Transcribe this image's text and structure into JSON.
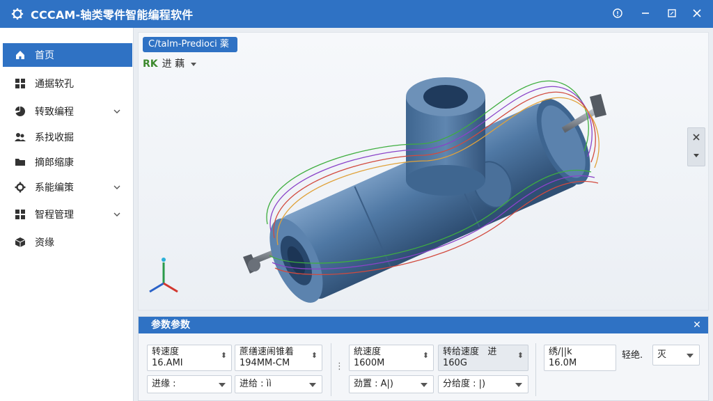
{
  "app": {
    "title": "CCCAM-轴类零件智能编程软件"
  },
  "window_controls": [
    "info-icon",
    "minimize-icon",
    "maximize-icon",
    "close-icon"
  ],
  "sidebar": {
    "items": [
      {
        "label": "首页",
        "icon": "home-icon",
        "active": true,
        "expandable": false
      },
      {
        "label": "通据软孔",
        "icon": "grid-icon",
        "active": false,
        "expandable": false
      },
      {
        "label": "转致编程",
        "icon": "pie-chart-icon",
        "active": false,
        "expandable": true
      },
      {
        "label": "系找收掘",
        "icon": "users-icon",
        "active": false,
        "expandable": false
      },
      {
        "label": "摘郎缩康",
        "icon": "folder-icon",
        "active": false,
        "expandable": false
      },
      {
        "label": "系能编策",
        "icon": "gear-icon",
        "active": false,
        "expandable": true
      },
      {
        "label": "智程管理",
        "icon": "apps-icon",
        "active": false,
        "expandable": true
      },
      {
        "label": "资缘",
        "icon": "box-icon",
        "active": false,
        "expandable": false
      }
    ]
  },
  "viewport": {
    "path_pill": "C/talm-Predioci 薬",
    "rk_code": "RK",
    "rk_label": "进 藕"
  },
  "param_panel": {
    "title": "参数参数",
    "fields": [
      {
        "label": "转速度",
        "value": "16.AMI"
      },
      {
        "label": "蔗缮速闹锥着",
        "value": "194MM-CM"
      },
      {
        "label": "統速度",
        "value": "1600M"
      },
      {
        "label": "转给速度",
        "label_suffix": "进",
        "value": "160G"
      },
      {
        "label": "绣/||k",
        "value": "16.0M"
      }
    ],
    "dropdowns": [
      {
        "label": "进缘 :"
      },
      {
        "label": "进给 : ìì"
      },
      {
        "label": "劲置 : A|)"
      },
      {
        "label": "分给度 : |)"
      }
    ],
    "side_label": "轻绝.",
    "side_select": "灭"
  },
  "colors": {
    "accent": "#2f72c4",
    "part_body": "#4f78a4",
    "toolpath_green": "#3fae3f",
    "toolpath_purple": "#8a43c8",
    "toolpath_red": "#d24a3e",
    "toolpath_orange": "#e0a23a"
  }
}
